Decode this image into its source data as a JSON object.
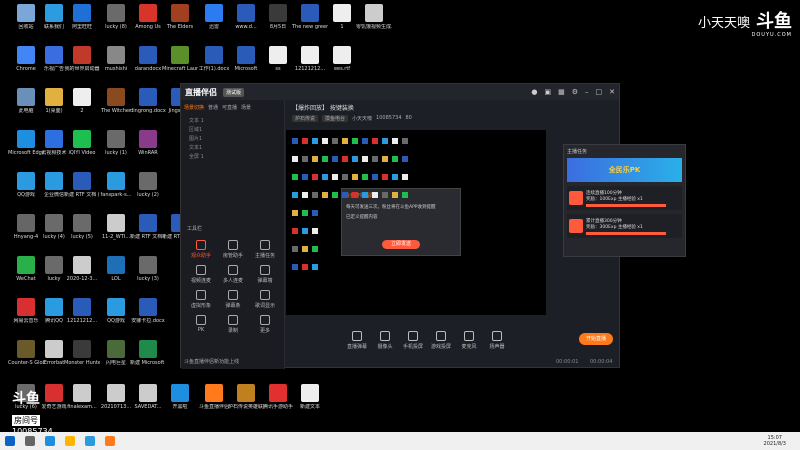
{
  "desktop": {
    "icons": [
      {
        "label": "回收站",
        "color": "#7aa7d8"
      },
      {
        "label": "联系我们",
        "color": "#2d9be0"
      },
      {
        "label": "阿里旺旺",
        "color": "#1e6fd6"
      },
      {
        "label": "lucky (8)",
        "color": "#6a6a6a"
      },
      {
        "label": "Among Us",
        "color": "#d8352a"
      },
      {
        "label": "The Elders",
        "color": "#a04020"
      },
      {
        "label": "迅雷",
        "color": "#2b7cf0"
      },
      {
        "label": "www.d...",
        "color": "#2b5bb8"
      },
      {
        "label": "8月5日",
        "color": "#3a3a3a"
      },
      {
        "label": "The new green rev...",
        "color": "#2b5bb8"
      },
      {
        "label": "1",
        "color": "#eeeeee"
      },
      {
        "label": "零饥饿视频生成.mp4",
        "color": "#cccccc"
      },
      {
        "label": "Chrome",
        "color": "#4285f4"
      },
      {
        "label": "乐视广告",
        "color": "#3a6ee0"
      },
      {
        "label": "我的世界启动器",
        "color": "#c0392b"
      },
      {
        "label": "mushishi",
        "color": "#888888"
      },
      {
        "label": "darandocx",
        "color": "#2b5bb8"
      },
      {
        "label": "Minecraft Launcher",
        "color": "#5a8f2a"
      },
      {
        "label": "工作(1).docx",
        "color": "#2b5bb8"
      },
      {
        "label": "Microsoft",
        "color": "#2b5bb8"
      },
      {
        "label": "ss",
        "color": "#eeeeee"
      },
      {
        "label": "12121212...",
        "color": "#eeeeee"
      },
      {
        "label": "ees.rtf",
        "color": "#eeeeee"
      },
      {
        "label": "此电脑",
        "color": "#6a8fb8"
      },
      {
        "label": "1(桌面)",
        "color": "#e0b040"
      },
      {
        "label": "2",
        "color": "#eeeeee"
      },
      {
        "label": "The Witcher",
        "color": "#8a4a20"
      },
      {
        "label": "dingrong.docx",
        "color": "#2b5bb8"
      },
      {
        "label": "Jingshe...",
        "color": "#2b5bb8"
      },
      {
        "label": "Microsoft Edge",
        "color": "#1e8fe0"
      },
      {
        "label": "云视频技术",
        "color": "#2d6fe0"
      },
      {
        "label": "iQIYI Video",
        "color": "#1fbf4f"
      },
      {
        "label": "lucky (1)",
        "color": "#6a6a6a"
      },
      {
        "label": "WinRAR",
        "color": "#8a3a8a"
      },
      {
        "label": "QQ游戏",
        "color": "#2a9be0"
      },
      {
        "label": "企业微信",
        "color": "#2a9be0"
      },
      {
        "label": "新建 RTF 文档 (2).rtf",
        "color": "#2b5bb8"
      },
      {
        "label": "fanspark-s...",
        "color": "#2b9be0"
      },
      {
        "label": "lucky (2)",
        "color": "#6a6a6a"
      },
      {
        "label": "Hnyang-4",
        "color": "#666666"
      },
      {
        "label": "lucky (4)",
        "color": "#6a6a6a"
      },
      {
        "label": "lucky (5)",
        "color": "#6a6a6a"
      },
      {
        "label": "11-2_WTI...",
        "color": "#cccccc"
      },
      {
        "label": "新建 RTF 文档 (3).rtf",
        "color": "#2b5bb8"
      },
      {
        "label": "新建 RTF resourc...",
        "color": "#2b5bb8"
      },
      {
        "label": "WeChat",
        "color": "#2ab04a"
      },
      {
        "label": "lucky",
        "color": "#6a6a6a"
      },
      {
        "label": "2020-12-3...",
        "color": "#cccccc"
      },
      {
        "label": "LOL",
        "color": "#1f6fb8"
      },
      {
        "label": "lucky (3)",
        "color": "#6a6a6a"
      },
      {
        "label": "网易云音乐",
        "color": "#d83030"
      },
      {
        "label": "腾讯QQ",
        "color": "#2a9be0"
      },
      {
        "label": "12121212...",
        "color": "#2b5bb8"
      },
      {
        "label": "QQ游戏",
        "color": "#2a9be0"
      },
      {
        "label": "安娜卡拉.docx",
        "color": "#2b5bb8"
      },
      {
        "label": "Counter-S Global Off...",
        "color": "#6a5a2a"
      },
      {
        "label": "Errorbat",
        "color": "#cccccc"
      },
      {
        "label": "Monster Hunter...",
        "color": "#3a3a3a"
      },
      {
        "label": "闪电巨星",
        "color": "#4a6a3a"
      },
      {
        "label": "新建 Microsoft Excel",
        "color": "#1f8a4a"
      },
      {
        "label": "lucky (6)",
        "color": "#6a6a6a"
      },
      {
        "label": "爱奇艺游戏",
        "color": "#d83030"
      },
      {
        "label": "finalexam...",
        "color": "#cccccc"
      },
      {
        "label": "20210713...",
        "color": "#cccccc"
      },
      {
        "label": "SAVEDAT...",
        "color": "#cccccc"
      },
      {
        "label": "开黑啦",
        "color": "#1e8fe0"
      },
      {
        "label": "斗鱼直播伴侣",
        "color": "#ff7a1a"
      },
      {
        "label": "炉石传说英雄联盟",
        "color": "#c08020"
      },
      {
        "label": "腾讯手游助手",
        "color": "#e03030"
      },
      {
        "label": "新建文本",
        "color": "#eeeeee"
      }
    ]
  },
  "watermark": {
    "name": "小天天噢",
    "logo": "斗鱼",
    "sub": "DOUYU.COM"
  },
  "room_badge": {
    "line1": "斗鱼",
    "line2": "房间号",
    "line3": "10085734"
  },
  "app": {
    "brand": "直播伴侣",
    "beta": "测试版",
    "left_tabs": [
      "场景切换",
      "普通",
      "可直播",
      "场景"
    ],
    "scenes": [
      "文本 1",
      "区域1",
      "图片1",
      "文本1",
      "全屏 1"
    ],
    "tools_header": "工具栏",
    "tools": [
      {
        "label": "观众助手",
        "hl": true
      },
      {
        "label": "房管助手",
        "hl": false
      },
      {
        "label": "主播任务",
        "hl": false
      },
      {
        "label": "视频连麦",
        "hl": false
      },
      {
        "label": "多人连麦",
        "hl": false
      },
      {
        "label": "弹幕墙",
        "hl": false
      },
      {
        "label": "虚拟形象",
        "hl": false
      },
      {
        "label": "弹幕条",
        "hl": false
      },
      {
        "label": "歌词显示",
        "hl": false
      },
      {
        "label": "PK",
        "hl": false
      },
      {
        "label": "录制",
        "hl": false
      },
      {
        "label": "更多",
        "hl": false
      }
    ],
    "notice": "斗鱼直播伴侣新功能上线",
    "room_title": "【爆炸回放】 按键装换",
    "room_tags": [
      "炉石传说",
      "摸鱼电台",
      "小天天噢",
      "10085734",
      "80"
    ],
    "dialog": {
      "title": "斗鱼开播提醒",
      "body": "每天可发送三次，粉丝将在斗鱼APP收到提醒",
      "hint": "已定义提醒内容",
      "button": "立即发送"
    },
    "task_panel": {
      "title": "主播任务",
      "banner": "全民乐PK",
      "tasks": [
        {
          "name": "连续直播100分钟",
          "reward": "奖励：100Exp 主播经验 x1"
        },
        {
          "name": "累计直播300分钟",
          "reward": "奖励：300Exp 主播经验 x1"
        }
      ]
    },
    "controls": [
      "直播弹幕",
      "摄像头",
      "手机投屏",
      "游戏投屏",
      "麦克风",
      "扬声器"
    ],
    "go_live": "开始直播",
    "stat_left": "00:00:01",
    "stat_right": "00:00:04"
  },
  "taskbar": {
    "time": "15:07",
    "date": "2021/8/3"
  }
}
